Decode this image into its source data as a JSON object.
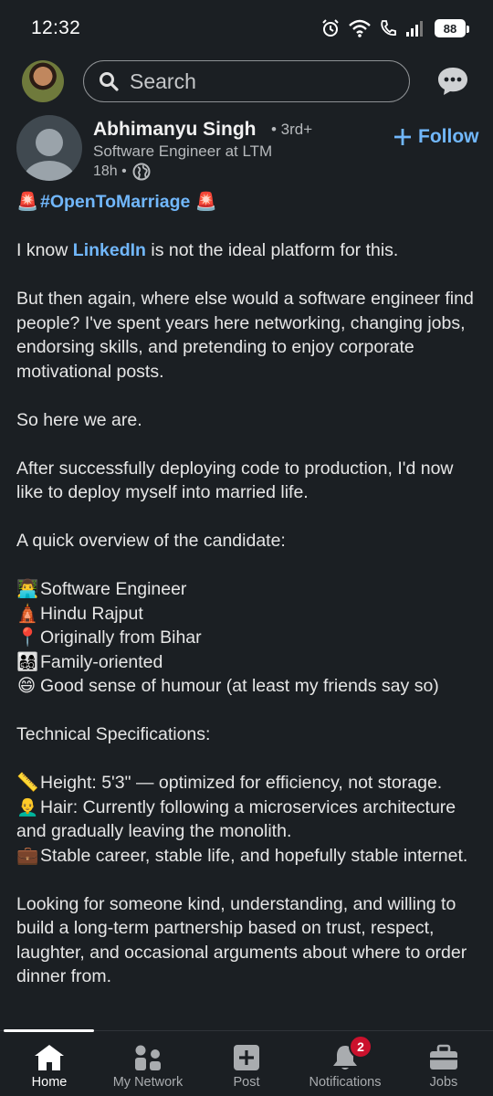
{
  "status_bar": {
    "time": "12:32",
    "battery": "88"
  },
  "topbar": {
    "search_placeholder": "Search"
  },
  "post": {
    "author_name": "Abhimanyu Singh",
    "degree": "• 3rd+",
    "headline": "Software Engineer at LTM",
    "time_ago": "18h •",
    "follow_label": "Follow",
    "hashtag": "#OpenToMarriage",
    "line_1_pre": "I know ",
    "line_1_mention": "LinkedIn",
    "line_1_post": "  is not the ideal platform for this.",
    "para_2": "But then again, where else would a software engineer find people? I've spent years here networking, changing jobs, endorsing skills, and pretending to enjoy corporate motivational posts.",
    "para_3": "So here we are.",
    "para_4": "After successfully deploying code to production, I'd now like to deploy myself into married life.",
    "para_5": "A quick overview of the candidate:",
    "overview": [
      {
        "emoji": "👨‍💻",
        "text": "Software Engineer"
      },
      {
        "emoji": "🛕",
        "text": "Hindu Rajput"
      },
      {
        "emoji": "📍",
        "text": "Originally from Bihar"
      },
      {
        "emoji": "👨‍👩‍👧‍👦",
        "text": "Family-oriented"
      },
      {
        "emoji": "😄",
        "text": "Good sense of humour (at least my friends say so)"
      }
    ],
    "para_6": "Technical Specifications:",
    "specs": [
      {
        "emoji": "📏",
        "text": "Height: 5'3\" — optimized for efficiency, not storage."
      },
      {
        "emoji": "👨‍🦲",
        "text": "Hair: Currently following a microservices architecture and gradually leaving the monolith."
      },
      {
        "emoji": "💼",
        "text": "Stable career, stable life, and hopefully stable internet."
      }
    ],
    "para_7": "Looking for someone kind, understanding, and willing to build a long-term partnership based on trust, respect, laughter, and occasional arguments about where to order dinner from."
  },
  "bottom_nav": {
    "items": [
      {
        "label": "Home"
      },
      {
        "label": "My Network"
      },
      {
        "label": "Post"
      },
      {
        "label": "Notifications"
      },
      {
        "label": "Jobs"
      }
    ],
    "notifications_badge": "2"
  }
}
